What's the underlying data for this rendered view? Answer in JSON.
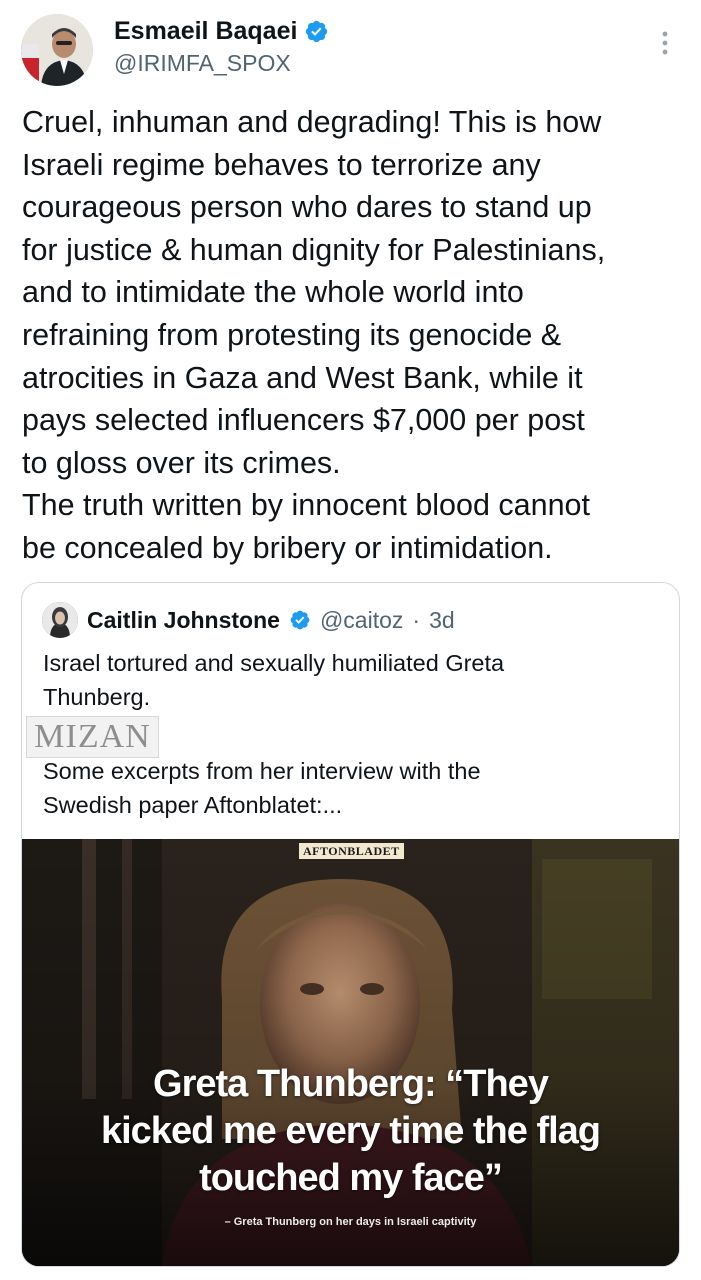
{
  "tweet": {
    "author_name": "Esmaeil Baqaei",
    "author_handle": "@IRIMFA_SPOX",
    "text": "Cruel, inhuman and degrading! This is how\nIsraeli regime behaves to terrorize any\ncourageous person who dares to stand up\nfor justice & human dignity for Palestinians,\nand to intimidate the whole world into\nrefraining from protesting its genocide &\natrocities in Gaza and West Bank, while it\npays selected influencers $7,000 per post\nto gloss over its crimes.\nThe truth written by innocent blood cannot\nbe concealed by bribery or intimidation."
  },
  "quoted": {
    "author_name": "Caitlin Johnstone",
    "author_handle": "@caitoz",
    "separator": "·",
    "time": "3d",
    "text_part1": "Israel tortured and sexually humiliated Greta\nThunberg.",
    "text_part2": "Some excerpts from her interview with the\nSwedish paper Aftonblatet:...",
    "media": {
      "brand": "AFTONBLADET",
      "headline": "Greta Thunberg: “They\nkicked me every time the flag\ntouched my face”",
      "caption": "– Greta Thunberg on her days in Israeli captivity"
    }
  },
  "watermark": "MIZAN",
  "icons": {
    "verified": "verified-badge-icon",
    "more": "more-options-icon"
  },
  "colors": {
    "verified": "#1d9bf0",
    "text": "#0f1419",
    "secondary": "#536471",
    "border": "#cfd9de"
  }
}
